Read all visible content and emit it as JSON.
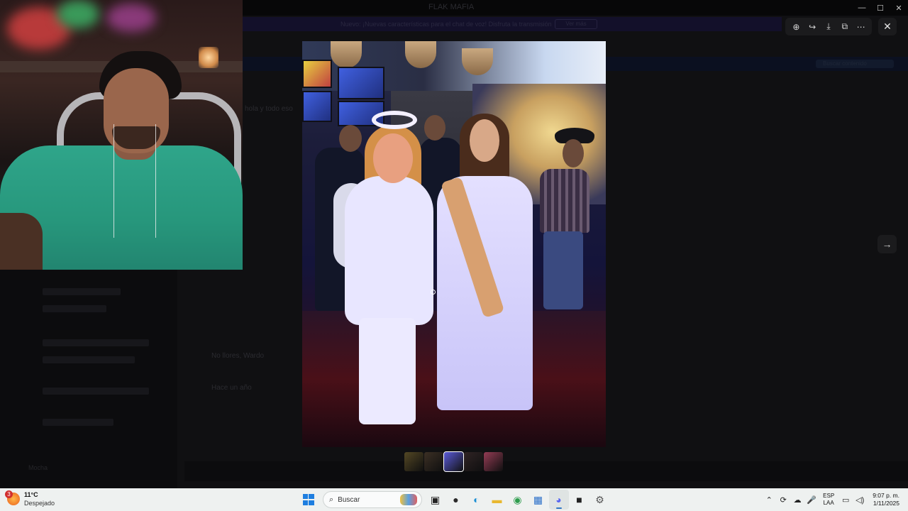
{
  "background_app": {
    "title": "FLAK MAFIA",
    "banner_text": "Nuevo: ¡Nuevas características para el chat de voz! Disfruta la transmisión",
    "banner_button": "Ver más",
    "search_placeholder": "Buscar contenido",
    "chat_lines": [
      "hola y todo eso",
      "No llores, Wardo",
      "Hace un año"
    ],
    "user_name": "Mocha"
  },
  "window_controls": [
    "—",
    "☐",
    "✕"
  ],
  "viewer": {
    "toolbar": [
      {
        "name": "zoom-in-icon",
        "glyph": "⊕"
      },
      {
        "name": "forward-icon",
        "glyph": "↪"
      },
      {
        "name": "download-icon",
        "glyph": "⤓"
      },
      {
        "name": "open-external-icon",
        "glyph": "⧉"
      },
      {
        "name": "more-options-icon",
        "glyph": "⋯"
      }
    ],
    "close_glyph": "✕",
    "next_glyph": "→",
    "thumbnail_count": 5,
    "active_thumbnail": 3,
    "thumbnail_colors": [
      "#6a5a2a",
      "#4a3a2a",
      "#5a5ad8",
      "#3a2a2a",
      "#c04a6a"
    ]
  },
  "taskbar": {
    "weather": {
      "badge": "3",
      "temp": "11°C",
      "condition": "Despejado"
    },
    "search_label": "Buscar",
    "apps": [
      {
        "name": "task-view-icon",
        "glyph": "▣",
        "color": "#222"
      },
      {
        "name": "obs-icon",
        "glyph": "●",
        "color": "#2a2a2a"
      },
      {
        "name": "edge-icon",
        "glyph": "◐",
        "color": "#1b8fd4"
      },
      {
        "name": "file-explorer-icon",
        "glyph": "▬",
        "color": "#e8b830"
      },
      {
        "name": "chrome-icon",
        "glyph": "◉",
        "color": "#2e9d4e"
      },
      {
        "name": "store-icon",
        "glyph": "▦",
        "color": "#2a6fc9"
      },
      {
        "name": "discord-icon",
        "glyph": "◕",
        "color": "#5865f2",
        "active": true
      },
      {
        "name": "epic-games-icon",
        "glyph": "■",
        "color": "#222"
      },
      {
        "name": "settings-icon",
        "glyph": "⚙",
        "color": "#555"
      }
    ],
    "tray_glyphs": [
      "⌃",
      "⟳",
      "☁",
      "🎤"
    ],
    "language": {
      "line1": "ESP",
      "line2": "LAA"
    },
    "time": "9:07 p. m.",
    "date": "1/11/2025"
  }
}
